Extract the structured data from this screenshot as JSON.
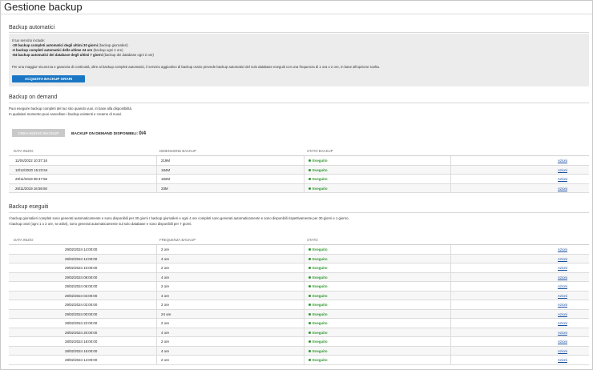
{
  "page": {
    "title": "Gestione backup"
  },
  "auto": {
    "title": "Backup automatici",
    "intro": "Il tuo servizio include:",
    "items": [
      {
        "bold": "-30 backup completi automatici degli ultimi 30 giorni",
        "rest": " (backup giornalieri)"
      },
      {
        "bold": "-6 backup completi automatici delle ultime 24 ore",
        "rest": " (backup ogni 4 ore)"
      },
      {
        "bold": "-84 backup automatici dei database degli ultimi 7 giorni",
        "rest": " (backup dei database ogni 2 ore)"
      }
    ],
    "note": "Per una maggior sicurezza e garanzia di continuità, oltre ai backup completi automatici, il servizio aggiuntivo di backup orario prevede backup automatici del solo database eseguiti con una frequenza di 1 ora o 2 ore, in base all'opzione scelta.",
    "button": "ACQUISTA BACKUP ORARI"
  },
  "ondemand": {
    "title": "Backup on demand",
    "line1": "Puoi eseguire backup completi del tuo sito quando vuoi, in base alla disponibilità.",
    "line2": "In qualsiasi momento puoi cancellare i backup esistenti e crearne di nuovi.",
    "button": "CREA NUOVO BACKUP",
    "quota_label": "BACKUP ON DEMAND DISPONIBILI:",
    "quota_value": "0/4",
    "headers": [
      "DATA INIZIO",
      "DIMENSIONE BACKUP",
      "STATO BACKUP"
    ],
    "rows": [
      {
        "date": "11/04/2022 10:37:16",
        "size": "219M",
        "status": "Eseguito",
        "action": "Azioni"
      },
      {
        "date": "10/12/2020 15:22:54",
        "size": "184M",
        "status": "Eseguito",
        "action": "Azioni"
      },
      {
        "date": "29/11/2019 08:47:56",
        "size": "182M",
        "status": "Eseguito",
        "action": "Azioni"
      },
      {
        "date": "26/11/2019 16:59:50",
        "size": "33M",
        "status": "Eseguito",
        "action": "Azioni"
      }
    ]
  },
  "done": {
    "title": "Backup eseguiti",
    "line1": "I backup giornalieri completi sono generati automaticamente e sono disponibili per 30 giorni I backup giornalieri e ogni 4 ore completi sono generati automaticamente e sono disponibili rispettivamente per 30 giorni e 1 giorno.",
    "line2": "I backup orari (ogni 1 o 2 ore, se attivi), sono generati automaticamente sul solo database e sono disponibili per 7 giorni.",
    "headers": [
      "DATA INIZIO",
      "FREQUENZA BACKUP",
      "STATO"
    ],
    "rows": [
      {
        "date": "29/02/2024 14:00:00",
        "freq": "2 ore",
        "status": "Eseguito",
        "action": "Azioni"
      },
      {
        "date": "29/02/2024 12:00:00",
        "freq": "4 ore",
        "status": "Eseguito",
        "action": "Azioni"
      },
      {
        "date": "29/02/2024 10:00:00",
        "freq": "2 ore",
        "status": "Eseguito",
        "action": "Azioni"
      },
      {
        "date": "29/02/2024 08:00:00",
        "freq": "4 ore",
        "status": "Eseguito",
        "action": "Azioni"
      },
      {
        "date": "29/02/2024 06:00:00",
        "freq": "2 ore",
        "status": "Eseguito",
        "action": "Azioni"
      },
      {
        "date": "29/02/2024 04:00:00",
        "freq": "4 ore",
        "status": "Eseguito",
        "action": "Azioni"
      },
      {
        "date": "29/02/2024 02:00:00",
        "freq": "2 ore",
        "status": "Eseguito",
        "action": "Azioni"
      },
      {
        "date": "29/02/2024 00:00:00",
        "freq": "24 ore",
        "status": "Eseguito",
        "action": "Azioni"
      },
      {
        "date": "28/02/2024 22:00:00",
        "freq": "2 ore",
        "status": "Eseguito",
        "action": "Azioni"
      },
      {
        "date": "28/02/2024 20:00:00",
        "freq": "4 ore",
        "status": "Eseguito",
        "action": "Azioni"
      },
      {
        "date": "28/02/2024 18:00:00",
        "freq": "2 ore",
        "status": "Eseguito",
        "action": "Azioni"
      },
      {
        "date": "28/02/2024 16:00:00",
        "freq": "4 ore",
        "status": "Eseguito",
        "action": "Azioni"
      },
      {
        "date": "28/02/2024 14:00:00",
        "freq": "2 ore",
        "status": "Eseguito",
        "action": "Azioni"
      }
    ]
  },
  "colors": {
    "accent": "#1a76c4",
    "success": "#2f9a2f",
    "link": "#1a4fa0"
  },
  "icons": {
    "status": "status-dot-icon",
    "cursor": "mouse-cursor-icon"
  }
}
